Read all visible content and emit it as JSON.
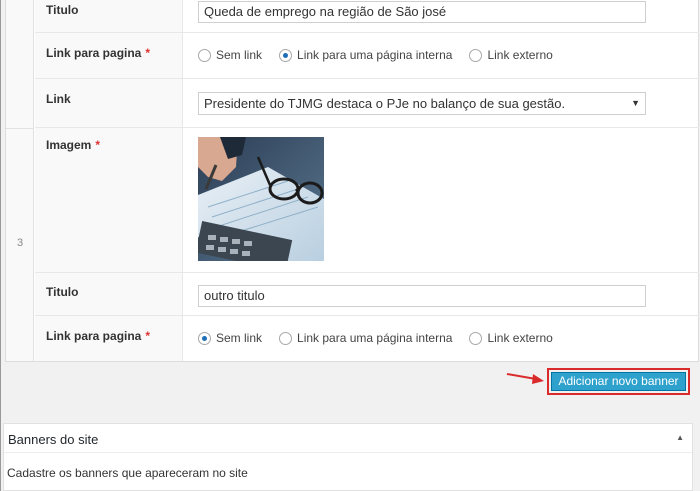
{
  "rows": {
    "upper": {
      "titulo_label": "Titulo",
      "titulo_value": "Queda de emprego na região de São josé",
      "link_para_pagina_label": "Link para pagina",
      "required_mark": "*",
      "link_options": [
        "Sem link",
        "Link para uma página interna",
        "Link externo"
      ],
      "link_selected": "Link para uma página interna",
      "link_label": "Link",
      "link_select_value": "Presidente do TJMG destaca o PJe no balanço de sua gestão."
    },
    "row3": {
      "index": "3",
      "imagem_label": "Imagem",
      "required_mark": "*",
      "titulo_label": "Titulo",
      "titulo_value": "outro titulo",
      "link_para_pagina_label": "Link para pagina",
      "link_options": [
        "Sem link",
        "Link para uma página interna",
        "Link externo"
      ],
      "link_selected": "Sem link"
    }
  },
  "add_banner_button": "Adicionar novo banner",
  "panel": {
    "title": "Banners do site",
    "description": "Cadastre os banners que apareceram no site",
    "toggle_icon": "triangle-up-icon"
  },
  "colors": {
    "button_bg": "#2ea2cc",
    "highlight_border": "#d92b2b",
    "required_star": "#dd3333",
    "radio_selected": "#1e6fb5"
  }
}
